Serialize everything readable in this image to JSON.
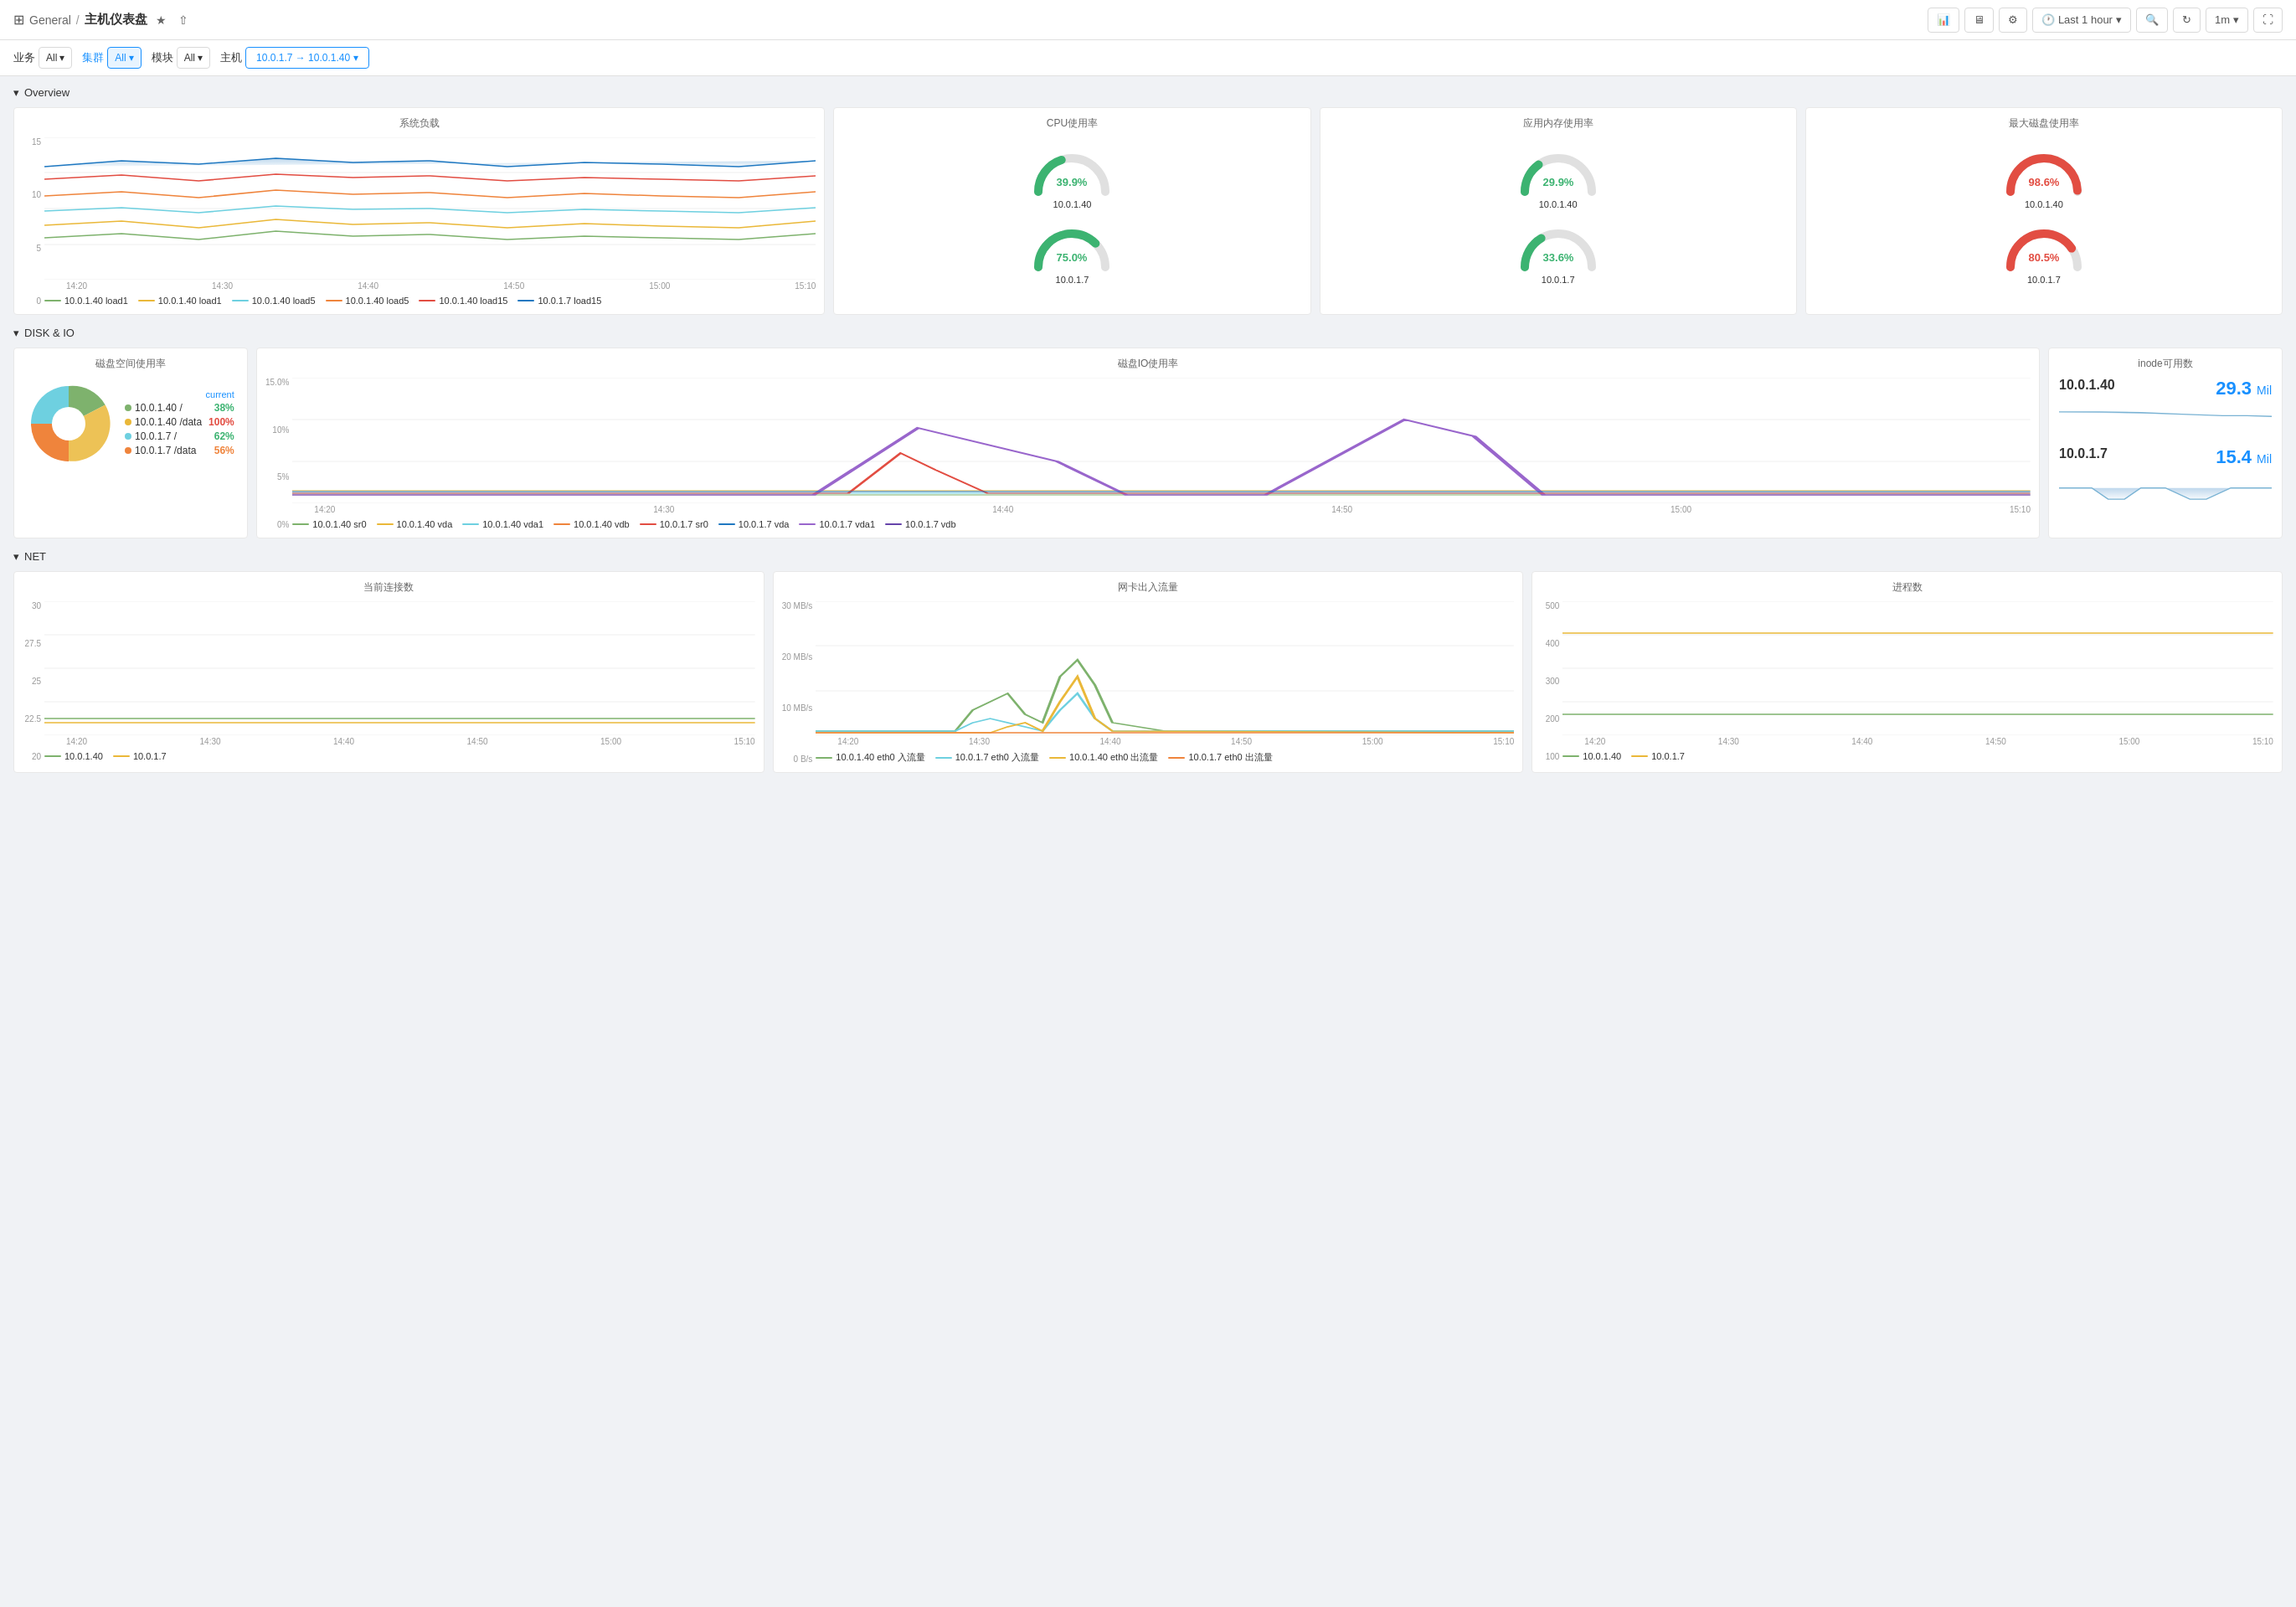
{
  "header": {
    "general_label": "General",
    "separator": "/",
    "title": "主机仪表盘",
    "star_icon": "★",
    "share_icon": "⇧",
    "add_panel_btn": "Add panel",
    "tv_icon": "TV",
    "settings_icon": "⚙",
    "time_label": "Last 1 hour",
    "zoom_out_icon": "🔍",
    "refresh_icon": "↻",
    "interval_label": "1m",
    "fullscreen_icon": "⛶"
  },
  "filters": {
    "service_label": "业务",
    "service_value": "All",
    "cluster_label": "集群",
    "cluster_value": "All",
    "module_label": "模块",
    "module_value": "All",
    "host_label": "主机",
    "host_value": "10.0.1.7 → 10.0.1.40"
  },
  "sections": {
    "overview": {
      "title": "Overview",
      "system_load": {
        "title": "系统负载",
        "y_labels": [
          "15",
          "10",
          "5",
          "0"
        ],
        "x_labels": [
          "14:20",
          "14:30",
          "14:40",
          "14:50",
          "15:00",
          "15:10"
        ],
        "legends": [
          {
            "label": "10.0.1.40 load1",
            "color": "#7eb26d"
          },
          {
            "label": "10.0.1.40 load1",
            "color": "#eab839"
          },
          {
            "label": "10.0.1.40 load5",
            "color": "#6ed0e0"
          },
          {
            "label": "10.0.1.40 load5",
            "color": "#ef843c"
          },
          {
            "label": "10.0.1.40 load15",
            "color": "#e24d42"
          },
          {
            "label": "10.0.1.7 load15",
            "color": "#1f78c1"
          }
        ]
      },
      "cpu_title": "CPU使用率",
      "mem_title": "应用内存使用率",
      "disk_title": "最大磁盘使用率",
      "gauges": {
        "cpu": [
          {
            "host": "10.0.1.40",
            "value": "39.9%",
            "color": "#3cb371",
            "pct": 39.9
          },
          {
            "host": "10.0.1.7",
            "value": "75.0%",
            "color": "#3cb371",
            "pct": 75.0
          }
        ],
        "mem": [
          {
            "host": "10.0.1.40",
            "value": "29.9%",
            "color": "#3cb371",
            "pct": 29.9
          },
          {
            "host": "10.0.1.7",
            "value": "33.6%",
            "color": "#3cb371",
            "pct": 33.6
          }
        ],
        "disk": [
          {
            "host": "10.0.1.40",
            "value": "98.6%",
            "color": "#e24d42",
            "pct": 98.6
          },
          {
            "host": "10.0.1.7",
            "value": "80.5%",
            "color": "#e24d42",
            "pct": 80.5
          }
        ]
      }
    },
    "disk_io": {
      "title": "DISK & IO",
      "space_title": "磁盘空间使用率",
      "io_title": "磁盘IO使用率",
      "inode_title": "inode可用数",
      "pie_data": [
        {
          "label": "10.0.1.40 /",
          "color": "#7eb26d",
          "value": "38%"
        },
        {
          "label": "10.0.1.40 /data",
          "color": "#eab839",
          "value": "100%"
        },
        {
          "label": "10.0.1.7 /",
          "color": "#6ed0e0",
          "value": "62%"
        },
        {
          "label": "10.0.1.7 /data",
          "color": "#ef843c",
          "value": "56%"
        }
      ],
      "io_y_labels": [
        "15.0%",
        "10%",
        "5%",
        "0%"
      ],
      "io_x_labels": [
        "14:20",
        "14:30",
        "14:40",
        "14:50",
        "15:00",
        "15:10"
      ],
      "io_legends": [
        {
          "label": "10.0.1.40 sr0",
          "color": "#7eb26d"
        },
        {
          "label": "10.0.1.40 vda",
          "color": "#eab839"
        },
        {
          "label": "10.0.1.40 vda1",
          "color": "#6ed0e0"
        },
        {
          "label": "10.0.1.40 vdb",
          "color": "#ef843c"
        },
        {
          "label": "10.0.1.7 sr0",
          "color": "#e24d42"
        },
        {
          "label": "10.0.1.7 vda",
          "color": "#1f78c1"
        },
        {
          "label": "10.0.1.7 vda1",
          "color": "#9966cc"
        },
        {
          "label": "10.0.1.7 vdb",
          "color": "#6644aa"
        }
      ],
      "inode_data": [
        {
          "host": "10.0.1.40",
          "value": "29.3",
          "unit": "Mil"
        },
        {
          "host": "10.0.1.7",
          "value": "15.4",
          "unit": "Mil"
        }
      ]
    },
    "net": {
      "title": "NET",
      "conn_title": "当前连接数",
      "conn_y_labels": [
        "30",
        "27.5",
        "25",
        "22.5",
        "20"
      ],
      "conn_x_labels": [
        "14:20",
        "14:30",
        "14:40",
        "14:50",
        "15:00",
        "15:10"
      ],
      "conn_legends": [
        {
          "label": "10.0.1.40",
          "color": "#7eb26d"
        },
        {
          "label": "10.0.1.7",
          "color": "#eab839"
        }
      ],
      "traffic_title": "网卡出入流量",
      "traffic_y_labels": [
        "30 MB/s",
        "20 MB/s",
        "10 MB/s",
        "0 B/s"
      ],
      "traffic_x_labels": [
        "14:20",
        "14:30",
        "14:40",
        "14:50",
        "15:00",
        "15:10"
      ],
      "traffic_legends": [
        {
          "label": "10.0.1.40 eth0 入流量",
          "color": "#7eb26d"
        },
        {
          "label": "10.0.1.7 eth0 入流量",
          "color": "#6ed0e0"
        },
        {
          "label": "10.0.1.40 eth0 出流量",
          "color": "#eab839"
        },
        {
          "label": "10.0.1.7 eth0 出流量",
          "color": "#ef843c"
        }
      ],
      "process_title": "进程数",
      "process_y_labels": [
        "500",
        "400",
        "300",
        "200",
        "100"
      ],
      "process_x_labels": [
        "14:20",
        "14:30",
        "14:40",
        "14:50",
        "15:00",
        "15:10"
      ],
      "process_legends": [
        {
          "label": "10.0.1.40",
          "color": "#7eb26d"
        },
        {
          "label": "10.0.1.7",
          "color": "#eab839"
        }
      ]
    }
  }
}
